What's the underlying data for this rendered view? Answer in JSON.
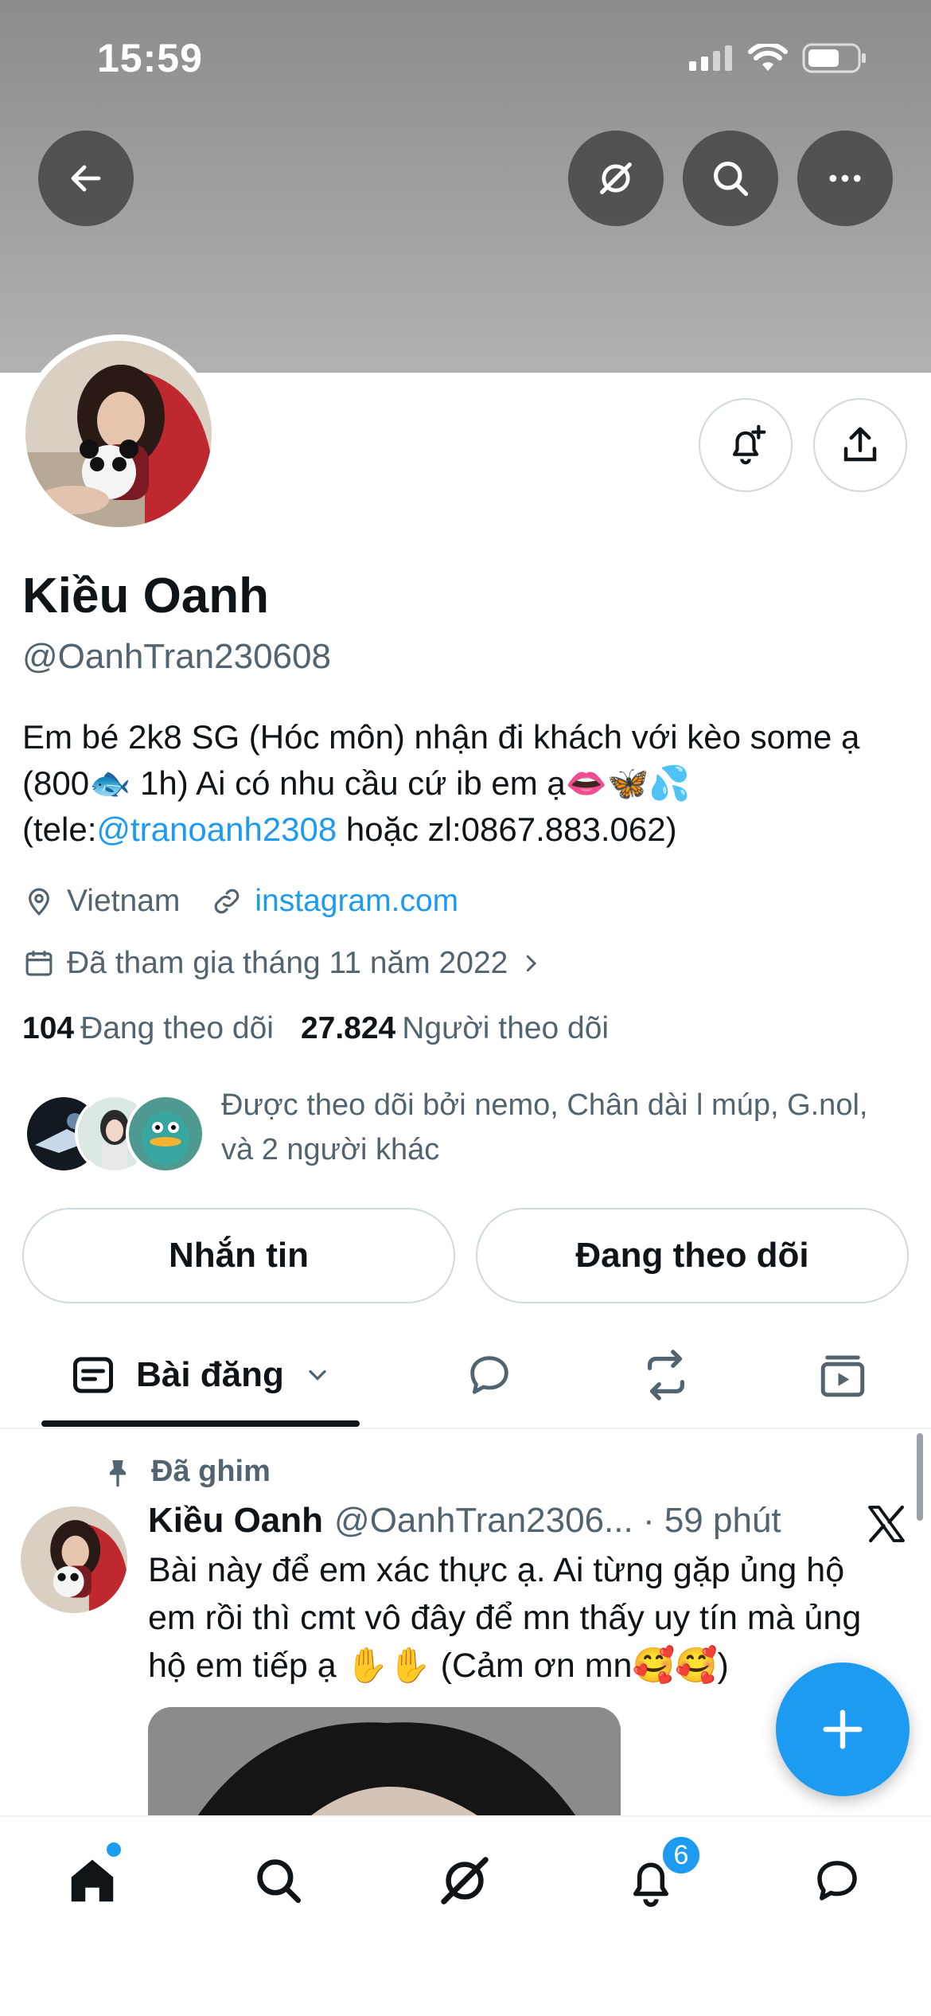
{
  "status_bar": {
    "time": "15:59"
  },
  "profile": {
    "name": "Kiều Oanh",
    "handle": "@OanhTran230608",
    "bio": {
      "line1": "Em bé 2k8 SG (Hóc môn) nhận đi khách với kèo some ạ",
      "line2": "(800🐟 1h) Ai có nhu cầu cứ ib em ạ👄🦋💦",
      "line3_prefix": "(tele:",
      "line3_link": "@tranoanh2308",
      "line3_suffix": " hoặc zl:0867.883.062)"
    },
    "location": "Vietnam",
    "website": "instagram.com",
    "joined": "Đã tham gia tháng 11 năm 2022",
    "following_count": "104",
    "following_label": "Đang theo dõi",
    "followers_count": "27.824",
    "followers_label": "Người theo dõi",
    "followed_by_line1": "Được theo dõi bởi nemo, Chân dài l múp, G.nol,",
    "followed_by_line2": "và 2 người khác"
  },
  "actions": {
    "message_label": "Nhắn tin",
    "following_label": "Đang theo dõi"
  },
  "tabs": {
    "posts_label": "Bài đăng"
  },
  "pinned_post": {
    "pinned_label": "Đã ghim",
    "author_name": "Kiều Oanh",
    "author_handle_time": "@OanhTran2306... · 59 phút",
    "text_line1": "Bài này để em xác thực ạ. Ai từng gặp ủng hộ",
    "text_line2": "em rồi thì cmt vô đây để mn thấy uy tín mà ủng",
    "text_line3": "hộ em tiếp ạ ✋✋ (Cảm ơn mn🥰🥰)"
  },
  "bottom_nav": {
    "notification_count": "6"
  },
  "colors": {
    "accent": "#1d9bf0",
    "text": "#0f1419",
    "muted": "#536471",
    "border": "#cfd9de"
  }
}
